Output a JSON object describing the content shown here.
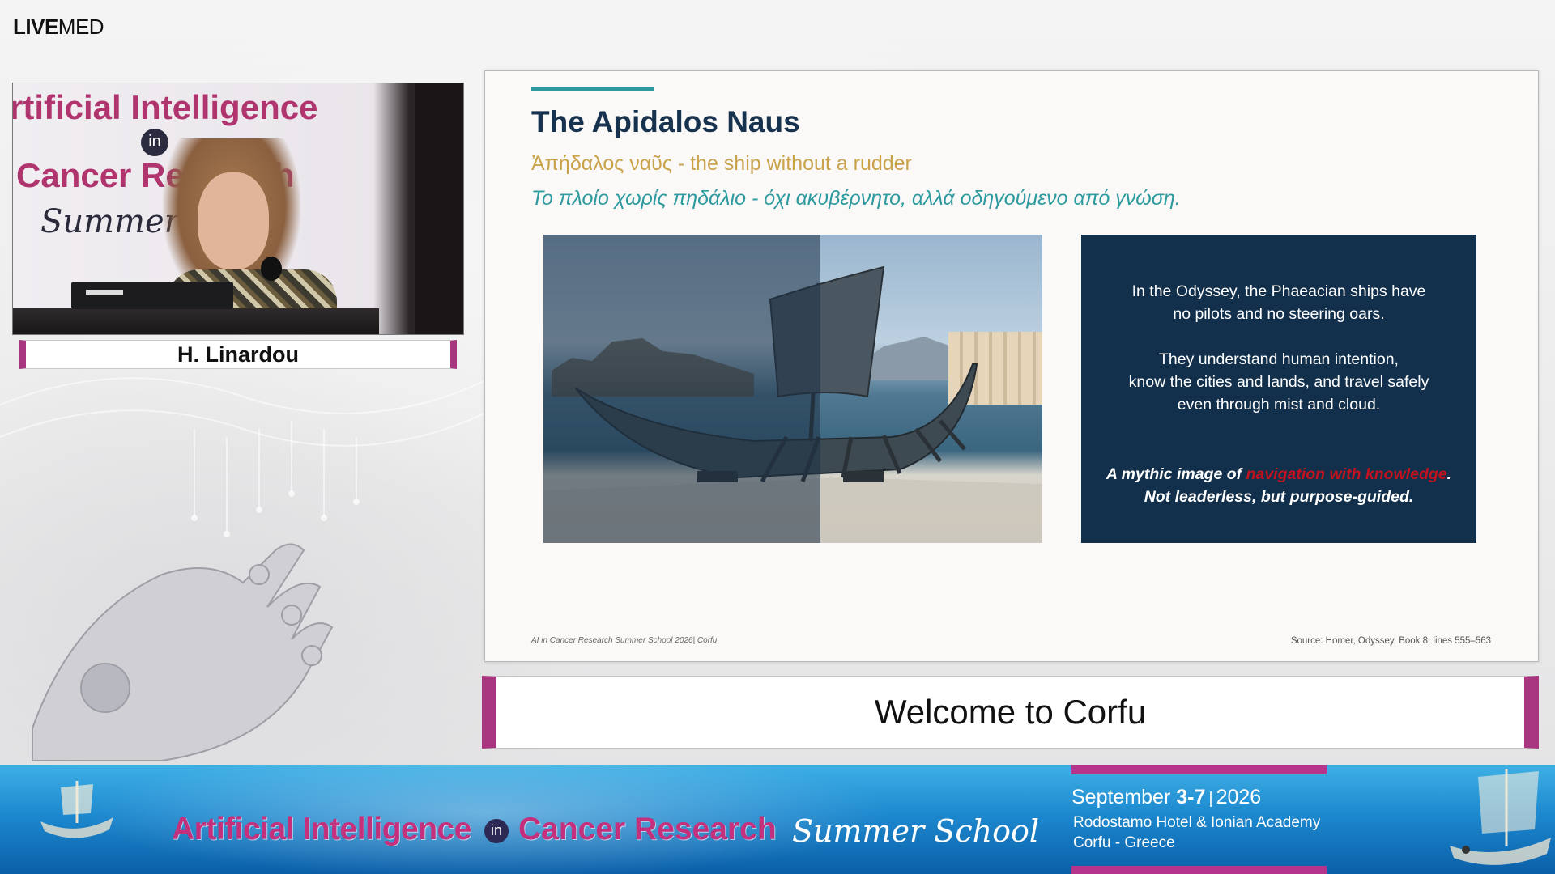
{
  "logo": {
    "bold": "LIVE",
    "regular": "MED"
  },
  "speaker": {
    "name": "H. Linardou",
    "video_banner": {
      "line1": "rtificial Intelligence",
      "in": "in",
      "line2": "Cancer Re",
      "line2_tail": "h",
      "line3": "Summer"
    }
  },
  "slide": {
    "title": "The Apidalos Naus",
    "subtitle": "Ἀπήδαλος ναῦς - the ship without a rudder",
    "greek_line": "Το πλοίο χωρίς πηδάλιο  - όχι ακυβέρνητο, αλλά οδηγούμενο από γνώση.",
    "textbox": {
      "p1_line1": "In the Odyssey, the Phaeacian ships have",
      "p1_line2": "no pilots and no steering oars.",
      "p2_line1": "They understand human intention,",
      "p2_line2": "know the cities and lands, and travel safely",
      "p2_line3": "even through mist and cloud.",
      "p3_prefix": "A mythic image of ",
      "p3_highlight": "navigation with knowledge",
      "p3_suffix": ".",
      "p3_line2": "Not leaderless, but purpose-guided."
    },
    "footer_left": "AI in Cancer Research Summer School 2026| Corfu",
    "footer_right": "Source: Homer, Odyssey, Book 8, lines 555–563"
  },
  "caption": "Welcome to Corfu",
  "banner": {
    "title": "Artificial Intelligence",
    "in": "in",
    "title2": "Cancer Research",
    "summer": "Summer School",
    "date_prefix": "September ",
    "date_days": "3-7",
    "date_sep": "|",
    "date_year": "2026",
    "venue": "Rodostamo Hotel & Ionian Academy",
    "location": "Corfu - Greece"
  },
  "colors": {
    "accent_magenta": "#a8367e",
    "slide_title": "#17324f",
    "teal": "#2d9aa0",
    "gold": "#c9a24a",
    "textbox_bg": "#12304b",
    "highlight_red": "#c1121f"
  }
}
